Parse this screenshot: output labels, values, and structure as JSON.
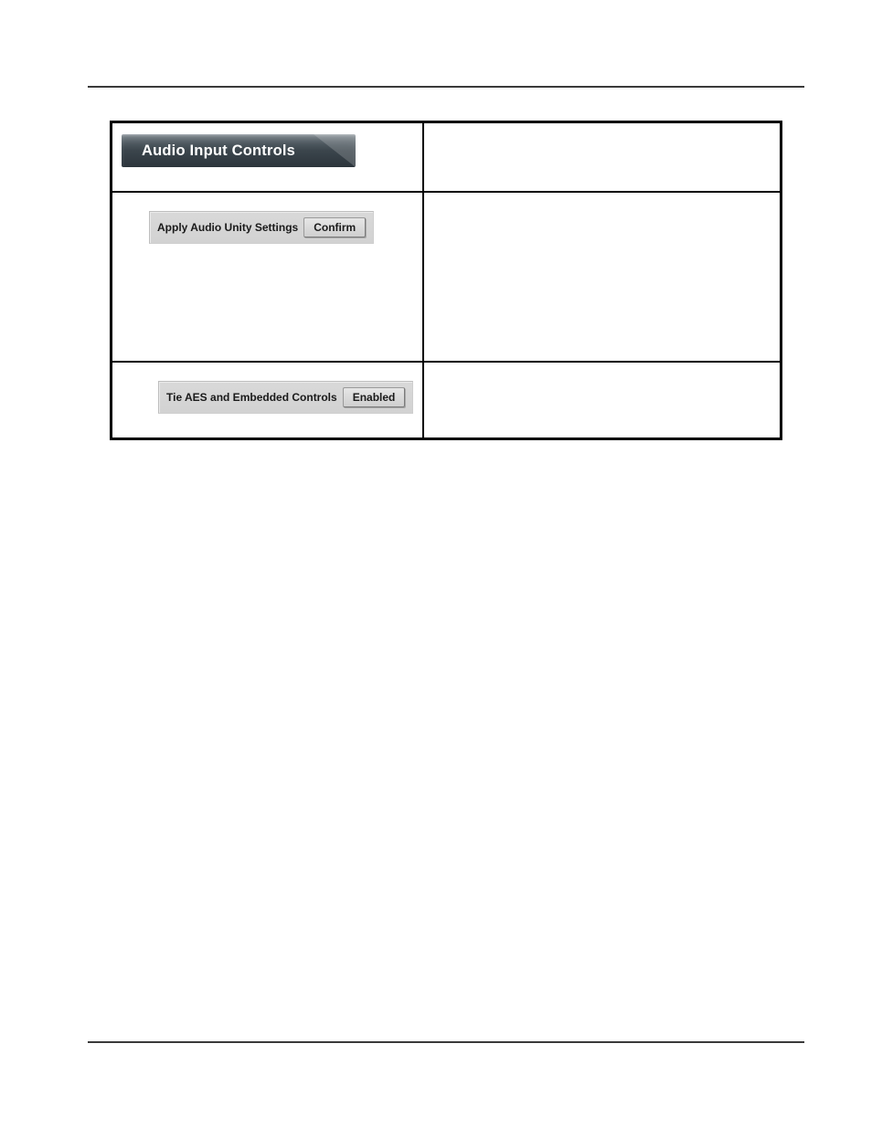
{
  "header": {
    "title": "Audio Input Controls"
  },
  "rows": [
    {
      "label": "Apply Audio Unity Settings",
      "button": "Confirm"
    },
    {
      "label": "Tie AES and Embedded Controls",
      "button": "Enabled"
    }
  ]
}
